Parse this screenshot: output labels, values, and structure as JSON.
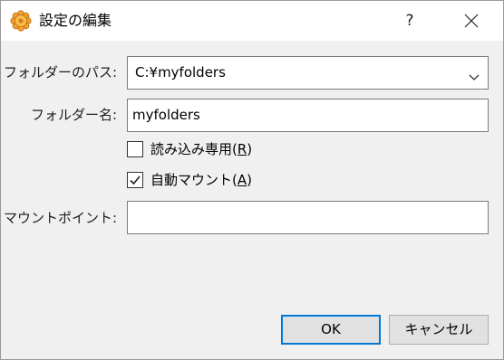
{
  "window": {
    "title": "設定の編集",
    "help_label": "?",
    "app_icon": "gear-flower-icon",
    "close_icon": "close-icon"
  },
  "form": {
    "folder_path": {
      "label": "フォルダーのパス:",
      "value": "C:¥myfolders",
      "dropdown_icon": "chevron-down-icon"
    },
    "folder_name": {
      "label": "フォルダー名:",
      "value": "myfolders"
    },
    "read_only": {
      "label_before": "読み込み専用(",
      "mnemonic": "R",
      "label_after": ")",
      "checked": false
    },
    "auto_mount": {
      "label_before": "自動マウント(",
      "mnemonic": "A",
      "label_after": ")",
      "checked": true
    },
    "mount_point": {
      "label": "マウントポイント:",
      "value": ""
    }
  },
  "buttons": {
    "ok_label": "OK",
    "cancel_label": "キャンセル"
  },
  "colors": {
    "titlebar": "#ffffff",
    "dialog_bg": "#f0f0f0",
    "focus_accent": "#0078d7",
    "icon_orange": "#f0a030"
  }
}
